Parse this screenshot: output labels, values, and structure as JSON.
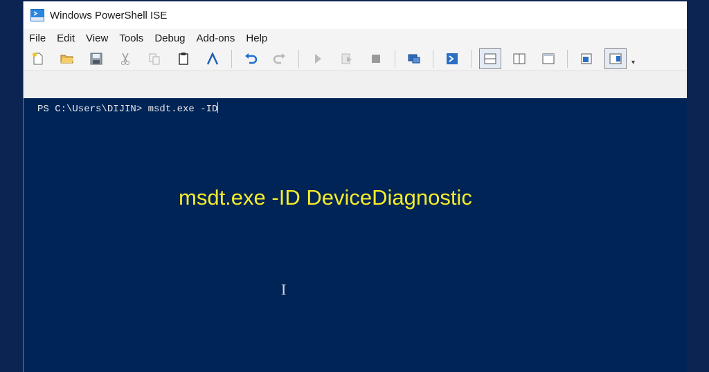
{
  "window": {
    "title": "Windows PowerShell ISE"
  },
  "menu": {
    "items": [
      "File",
      "Edit",
      "View",
      "Tools",
      "Debug",
      "Add-ons",
      "Help"
    ]
  },
  "toolbar": {
    "icons": [
      "new-file-icon",
      "open-folder-icon",
      "save-icon",
      "cut-icon",
      "copy-icon",
      "paste-icon",
      "clear-console-icon",
      "undo-icon",
      "redo-icon",
      "run-script-icon",
      "run-selection-icon",
      "stop-icon",
      "remote-powershell-icon",
      "powershell-console-icon",
      "script-pane-top-icon",
      "script-pane-right-icon",
      "script-pane-maximized-icon",
      "show-command-window-icon",
      "show-command-addon-icon"
    ]
  },
  "console": {
    "prompt_text": "PS C:\\Users\\DIJIN> msdt.exe -ID"
  },
  "overlay": {
    "caption": "msdt.exe -ID DeviceDiagnostic",
    "color": "#f4ec2a"
  },
  "colors": {
    "console_bg": "#012456",
    "outer_bg": "#0b2452"
  }
}
